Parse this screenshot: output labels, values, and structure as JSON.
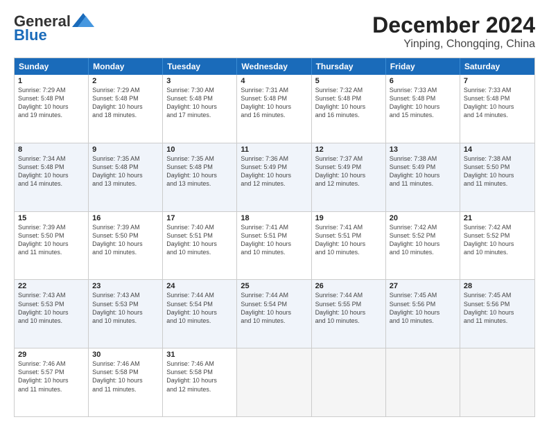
{
  "logo": {
    "line1": "General",
    "line2": "Blue"
  },
  "title": "December 2024",
  "subtitle": "Yinping, Chongqing, China",
  "headers": [
    "Sunday",
    "Monday",
    "Tuesday",
    "Wednesday",
    "Thursday",
    "Friday",
    "Saturday"
  ],
  "weeks": [
    [
      {
        "day": "1",
        "lines": [
          "Sunrise: 7:29 AM",
          "Sunset: 5:48 PM",
          "Daylight: 10 hours",
          "and 19 minutes."
        ]
      },
      {
        "day": "2",
        "lines": [
          "Sunrise: 7:29 AM",
          "Sunset: 5:48 PM",
          "Daylight: 10 hours",
          "and 18 minutes."
        ]
      },
      {
        "day": "3",
        "lines": [
          "Sunrise: 7:30 AM",
          "Sunset: 5:48 PM",
          "Daylight: 10 hours",
          "and 17 minutes."
        ]
      },
      {
        "day": "4",
        "lines": [
          "Sunrise: 7:31 AM",
          "Sunset: 5:48 PM",
          "Daylight: 10 hours",
          "and 16 minutes."
        ]
      },
      {
        "day": "5",
        "lines": [
          "Sunrise: 7:32 AM",
          "Sunset: 5:48 PM",
          "Daylight: 10 hours",
          "and 16 minutes."
        ]
      },
      {
        "day": "6",
        "lines": [
          "Sunrise: 7:33 AM",
          "Sunset: 5:48 PM",
          "Daylight: 10 hours",
          "and 15 minutes."
        ]
      },
      {
        "day": "7",
        "lines": [
          "Sunrise: 7:33 AM",
          "Sunset: 5:48 PM",
          "Daylight: 10 hours",
          "and 14 minutes."
        ]
      }
    ],
    [
      {
        "day": "8",
        "lines": [
          "Sunrise: 7:34 AM",
          "Sunset: 5:48 PM",
          "Daylight: 10 hours",
          "and 14 minutes."
        ]
      },
      {
        "day": "9",
        "lines": [
          "Sunrise: 7:35 AM",
          "Sunset: 5:48 PM",
          "Daylight: 10 hours",
          "and 13 minutes."
        ]
      },
      {
        "day": "10",
        "lines": [
          "Sunrise: 7:35 AM",
          "Sunset: 5:48 PM",
          "Daylight: 10 hours",
          "and 13 minutes."
        ]
      },
      {
        "day": "11",
        "lines": [
          "Sunrise: 7:36 AM",
          "Sunset: 5:49 PM",
          "Daylight: 10 hours",
          "and 12 minutes."
        ]
      },
      {
        "day": "12",
        "lines": [
          "Sunrise: 7:37 AM",
          "Sunset: 5:49 PM",
          "Daylight: 10 hours",
          "and 12 minutes."
        ]
      },
      {
        "day": "13",
        "lines": [
          "Sunrise: 7:38 AM",
          "Sunset: 5:49 PM",
          "Daylight: 10 hours",
          "and 11 minutes."
        ]
      },
      {
        "day": "14",
        "lines": [
          "Sunrise: 7:38 AM",
          "Sunset: 5:50 PM",
          "Daylight: 10 hours",
          "and 11 minutes."
        ]
      }
    ],
    [
      {
        "day": "15",
        "lines": [
          "Sunrise: 7:39 AM",
          "Sunset: 5:50 PM",
          "Daylight: 10 hours",
          "and 11 minutes."
        ]
      },
      {
        "day": "16",
        "lines": [
          "Sunrise: 7:39 AM",
          "Sunset: 5:50 PM",
          "Daylight: 10 hours",
          "and 10 minutes."
        ]
      },
      {
        "day": "17",
        "lines": [
          "Sunrise: 7:40 AM",
          "Sunset: 5:51 PM",
          "Daylight: 10 hours",
          "and 10 minutes."
        ]
      },
      {
        "day": "18",
        "lines": [
          "Sunrise: 7:41 AM",
          "Sunset: 5:51 PM",
          "Daylight: 10 hours",
          "and 10 minutes."
        ]
      },
      {
        "day": "19",
        "lines": [
          "Sunrise: 7:41 AM",
          "Sunset: 5:51 PM",
          "Daylight: 10 hours",
          "and 10 minutes."
        ]
      },
      {
        "day": "20",
        "lines": [
          "Sunrise: 7:42 AM",
          "Sunset: 5:52 PM",
          "Daylight: 10 hours",
          "and 10 minutes."
        ]
      },
      {
        "day": "21",
        "lines": [
          "Sunrise: 7:42 AM",
          "Sunset: 5:52 PM",
          "Daylight: 10 hours",
          "and 10 minutes."
        ]
      }
    ],
    [
      {
        "day": "22",
        "lines": [
          "Sunrise: 7:43 AM",
          "Sunset: 5:53 PM",
          "Daylight: 10 hours",
          "and 10 minutes."
        ]
      },
      {
        "day": "23",
        "lines": [
          "Sunrise: 7:43 AM",
          "Sunset: 5:53 PM",
          "Daylight: 10 hours",
          "and 10 minutes."
        ]
      },
      {
        "day": "24",
        "lines": [
          "Sunrise: 7:44 AM",
          "Sunset: 5:54 PM",
          "Daylight: 10 hours",
          "and 10 minutes."
        ]
      },
      {
        "day": "25",
        "lines": [
          "Sunrise: 7:44 AM",
          "Sunset: 5:54 PM",
          "Daylight: 10 hours",
          "and 10 minutes."
        ]
      },
      {
        "day": "26",
        "lines": [
          "Sunrise: 7:44 AM",
          "Sunset: 5:55 PM",
          "Daylight: 10 hours",
          "and 10 minutes."
        ]
      },
      {
        "day": "27",
        "lines": [
          "Sunrise: 7:45 AM",
          "Sunset: 5:56 PM",
          "Daylight: 10 hours",
          "and 10 minutes."
        ]
      },
      {
        "day": "28",
        "lines": [
          "Sunrise: 7:45 AM",
          "Sunset: 5:56 PM",
          "Daylight: 10 hours",
          "and 11 minutes."
        ]
      }
    ],
    [
      {
        "day": "29",
        "lines": [
          "Sunrise: 7:46 AM",
          "Sunset: 5:57 PM",
          "Daylight: 10 hours",
          "and 11 minutes."
        ]
      },
      {
        "day": "30",
        "lines": [
          "Sunrise: 7:46 AM",
          "Sunset: 5:58 PM",
          "Daylight: 10 hours",
          "and 11 minutes."
        ]
      },
      {
        "day": "31",
        "lines": [
          "Sunrise: 7:46 AM",
          "Sunset: 5:58 PM",
          "Daylight: 10 hours",
          "and 12 minutes."
        ]
      },
      {
        "day": "",
        "lines": []
      },
      {
        "day": "",
        "lines": []
      },
      {
        "day": "",
        "lines": []
      },
      {
        "day": "",
        "lines": []
      }
    ]
  ]
}
